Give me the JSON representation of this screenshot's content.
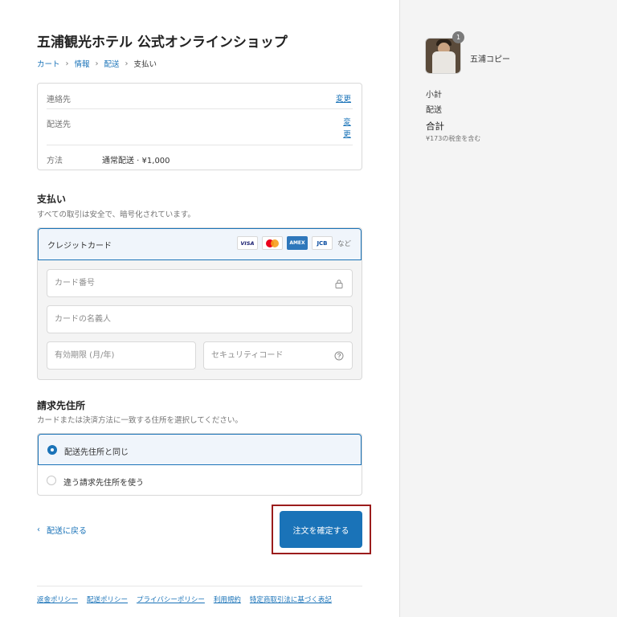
{
  "header": {
    "shop_title": "五浦観光ホテル 公式オンラインショップ"
  },
  "breadcrumb": {
    "items": [
      "カート",
      "情報",
      "配送",
      "支払い"
    ],
    "separator": "›"
  },
  "summary": {
    "contact_label": "連絡先",
    "shipping_label": "配送先",
    "method_label": "方法",
    "method_value": "通常配送 · ¥1,000",
    "change_label": "変更",
    "change_label_stacked": "変更"
  },
  "payment": {
    "title": "支払い",
    "subtitle": "すべての取引は安全で、暗号化されています。",
    "method_name": "クレジットカード",
    "brands": [
      "VISA",
      "mastercard",
      "AMEX",
      "JCB"
    ],
    "brands_more": "など",
    "card_number_placeholder": "カード番号",
    "name_placeholder": "カードの名義人",
    "expiry_placeholder": "有効期限 (月/年)",
    "cvc_placeholder": "セキュリティコード"
  },
  "billing": {
    "title": "請求先住所",
    "subtitle": "カードまたは決済方法に一致する住所を選択してください。",
    "options": [
      {
        "label": "配送先住所と同じ",
        "selected": true
      },
      {
        "label": "違う請求先住所を使う",
        "selected": false
      }
    ]
  },
  "actions": {
    "back_icon": "‹",
    "back_label": "配送に戻る",
    "confirm_label": "注文を確定する"
  },
  "footer": {
    "links": [
      "返金ポリシー",
      "配送ポリシー",
      "プライバシーポリシー",
      "利用規約",
      "特定商取引法に基づく表記"
    ]
  },
  "order": {
    "quantity": "1",
    "product_name": "五浦コピー",
    "subtotal_label": "小計",
    "shipping_label": "配送",
    "total_label": "合計",
    "tax_note": "¥173の税金を含む"
  },
  "colors": {
    "accent": "#1a73b8",
    "highlight_frame": "#9b1c1c",
    "sidebar_bg": "#f4f4f4"
  }
}
